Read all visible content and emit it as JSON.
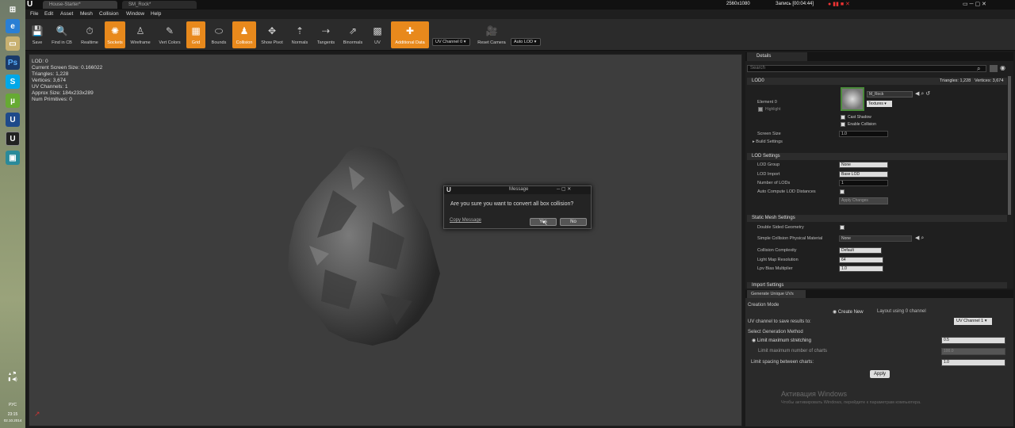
{
  "taskbar": {
    "time": "23:15",
    "date": "02.10.2014",
    "lang": "РУС"
  },
  "titlebar": {
    "tabs": [
      "House-Starter*",
      "SM_Rock*"
    ],
    "recording": "2560x1080",
    "rec_label": "Запись [00:04:44]"
  },
  "menu": [
    "File",
    "Edit",
    "Asset",
    "Mesh",
    "Collision",
    "Window",
    "Help"
  ],
  "toolbar": {
    "tools": [
      {
        "label": "Save",
        "on": false
      },
      {
        "label": "Find in CB",
        "on": false
      },
      {
        "label": "Realtime",
        "on": false
      },
      {
        "label": "Sockets",
        "on": true
      },
      {
        "label": "Wireframe",
        "on": false
      },
      {
        "label": "Vert Colors",
        "on": false
      },
      {
        "label": "Grid",
        "on": true
      },
      {
        "label": "Bounds",
        "on": false
      },
      {
        "label": "Collision",
        "on": true
      },
      {
        "label": "Show Pivot",
        "on": false
      },
      {
        "label": "Normals",
        "on": false
      },
      {
        "label": "Tangents",
        "on": false
      },
      {
        "label": "Binormals",
        "on": false
      },
      {
        "label": "UV",
        "on": false
      },
      {
        "label": "Additional Data",
        "on": true
      }
    ],
    "uv_channel": "UV Channel 0",
    "reset_camera": "Reset Camera",
    "auto_lod": "Auto LOD"
  },
  "viewport": {
    "stats": [
      "LOD: 0",
      "Current Screen Size: 0.166022",
      "Triangles: 1,228",
      "Vertices: 3,674",
      "UV Channels: 1",
      "Approx Size: 184x233x289",
      "Num Primitives: 0"
    ]
  },
  "dialog": {
    "title": "Message",
    "text": "Are you sure you want to convert all box collision?",
    "copy": "Copy Message",
    "yes": "Yes",
    "no": "No"
  },
  "details": {
    "tab": "Details",
    "search_placeholder": "Search",
    "lod0": "LOD0",
    "lod_stats_tris": "Triangles: 1,228",
    "lod_stats_verts": "Vertices: 3,674",
    "element": "Element 0",
    "highlight": "Highlight",
    "material": "M_Rock",
    "textures": "Textures",
    "cast_shadow": "Cast Shadow",
    "enable_collision": "Enable Collision",
    "screen_size": "Screen Size",
    "screen_size_val": "1.0",
    "build_settings": "Build Settings",
    "lod_settings": "LOD Settings",
    "lod_group": "LOD Group",
    "lod_group_val": "None",
    "lod_import": "LOD Import",
    "lod_import_val": "Base LOD",
    "num_lods": "Number of LODs",
    "num_lods_val": "1",
    "auto_compute": "Auto Compute LOD Distances",
    "apply_changes": "Apply Changes",
    "sm_settings": "Static Mesh Settings",
    "double_sided": "Double Sided Geometry",
    "simple_coll": "Simple Collision Physical Material",
    "simple_coll_val": "None",
    "coll_complex": "Collision Complexity",
    "coll_complex_val": "Default",
    "lightmap_res": "Light Map Resolution",
    "lightmap_res_val": "64",
    "lpv_bias": "Lpv Bias Multiplier",
    "lpv_bias_val": "1.0",
    "import_settings": "Import Settings"
  },
  "uvpanel": {
    "tab": "Generate Unique UVs",
    "creation_mode": "Creation Mode",
    "create_new": "Create New",
    "layout_using": "Layout using 0 channel",
    "uv_save": "UV channel to save results to:",
    "uv_save_val": "UV Channel 1",
    "gen_method": "Select Generation Method",
    "limit_stretch": "Limit maximum stretching",
    "limit_stretch_val": "0.5",
    "limit_charts": "Limit maximum number of charts",
    "limit_charts_val": "100.0",
    "limit_spacing": "Limit spacing between charts:",
    "limit_spacing_val": "1.0",
    "apply": "Apply",
    "activation": "Активация Windows",
    "activation_sub": "Чтобы активировать Windows, перейдите к параметрам компьютера."
  }
}
